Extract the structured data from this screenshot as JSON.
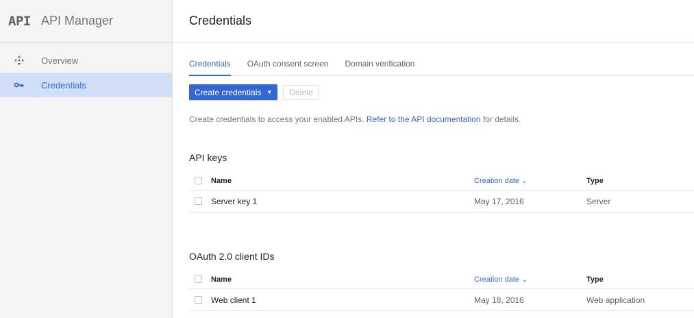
{
  "sidebar": {
    "logo": "API",
    "title": "API Manager",
    "items": [
      {
        "label": "Overview",
        "icon": "move-arrows-icon"
      },
      {
        "label": "Credentials",
        "icon": "key-icon",
        "active": true
      }
    ]
  },
  "main": {
    "title": "Credentials",
    "tabs": [
      {
        "label": "Credentials",
        "active": true
      },
      {
        "label": "OAuth consent screen"
      },
      {
        "label": "Domain verification"
      }
    ],
    "create_label": "Create credentials",
    "delete_label": "Delete",
    "help_prefix": "Create credentials to access your enabled APIs.",
    "help_link": "Refer to the API documentation",
    "help_suffix": "for details."
  },
  "api_keys": {
    "title": "API keys",
    "headers": {
      "name": "Name",
      "date": "Creation date",
      "type": "Type"
    },
    "rows": [
      {
        "name": "Server key 1",
        "date": "May 17, 2016",
        "type": "Server"
      }
    ]
  },
  "oauth": {
    "title": "OAuth 2.0 client IDs",
    "headers": {
      "name": "Name",
      "date": "Creation date",
      "type": "Type"
    },
    "rows": [
      {
        "name": "Web client 1",
        "date": "May 18, 2016",
        "type": "Web application"
      }
    ]
  },
  "colors": {
    "accent": "#3367d6",
    "active_nav_bg": "#d0def7"
  }
}
